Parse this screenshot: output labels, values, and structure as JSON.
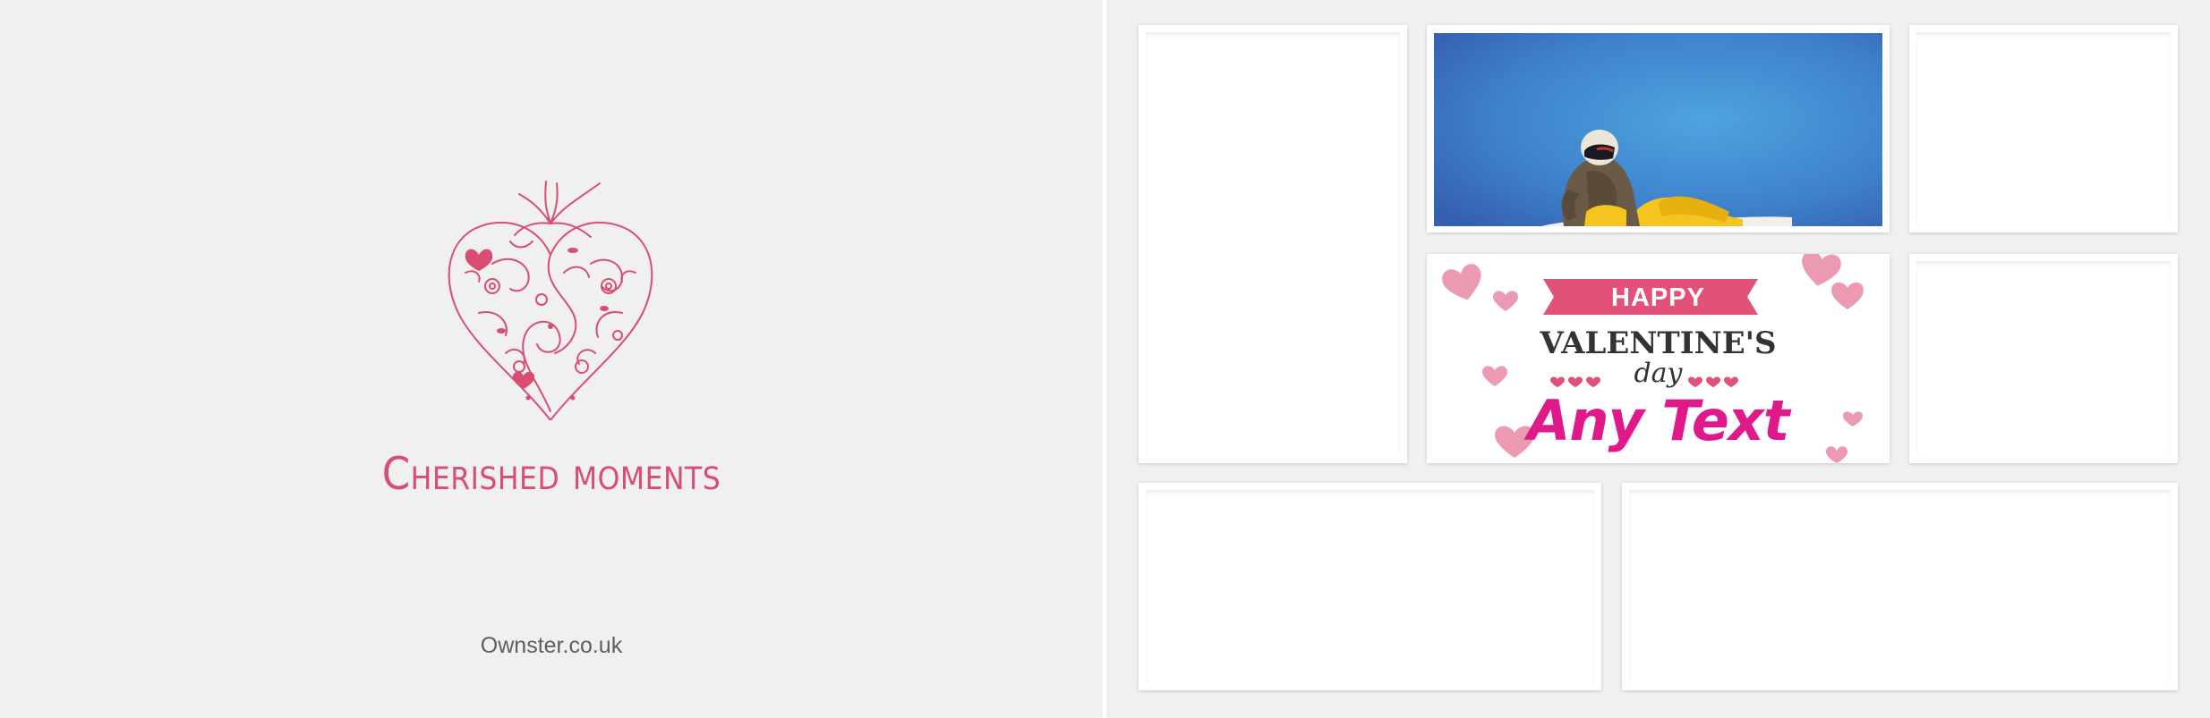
{
  "left_page": {
    "title": "Cherished moments",
    "website": "Ownster.co.uk",
    "heart_icon": "ornamental-floral-heart"
  },
  "right_page": {
    "valentine_card": {
      "ribbon_text": "HAPPY",
      "headline": "VALENTINE'S",
      "subline": "day",
      "custom_text": "Any Text"
    }
  },
  "colors": {
    "background": "#f0f0f0",
    "accent_pink": "#d94d72",
    "magenta": "#e0198a",
    "sky_blue": "#3e8ad3"
  }
}
